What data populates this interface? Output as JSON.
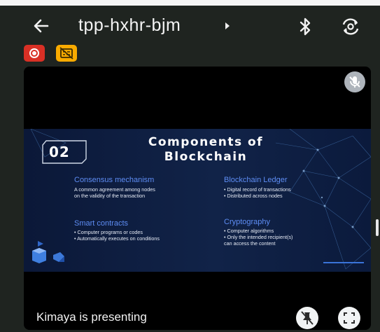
{
  "meeting": {
    "code": "tpp-hxhr-bjm"
  },
  "icons": {
    "back": "arrow-left-icon",
    "title_caret": "caret-right-icon",
    "bluetooth": "bluetooth-icon",
    "switch_camera": "switch-camera-icon",
    "recording": "record-icon",
    "captions_off": "captions-off-icon",
    "mic_off": "mic-off-icon",
    "unpin": "unpin-icon",
    "fullscreen": "fullscreen-icon"
  },
  "colors": {
    "recording_badge": "#d93025",
    "captions_badge": "#f9ab00",
    "slide_heading": "#5e8df4",
    "slide_background": "#0b1838"
  },
  "slide": {
    "number": "02",
    "title_line1": "Components of",
    "title_line2": "Blockchain",
    "sections": [
      {
        "heading": "Consensus mechanism",
        "body": "A common agreement among nodes\non the validity of the transaction"
      },
      {
        "heading": "Blockchain Ledger",
        "body": "• Digital record of transactions\n• Distributed across nodes"
      },
      {
        "heading": "Smart contracts",
        "body": "• Computer programs or codes\n• Automatically executes on conditions"
      },
      {
        "heading": "Cryptography",
        "body": "• Computer algorithms\n• Only the intended recipient(s)\ncan access the content"
      }
    ]
  },
  "presenter": {
    "label": "Kimaya is presenting"
  }
}
